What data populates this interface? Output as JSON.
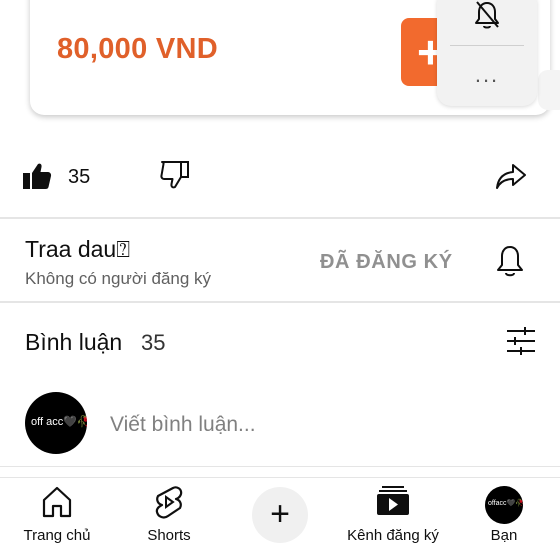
{
  "product": {
    "price": "80,000 VND",
    "buy_button_glyph": "+"
  },
  "popup_menu": {
    "icons": [
      "bell-off-icon"
    ],
    "more_label": "..."
  },
  "actions": {
    "like_count": "35",
    "icons": [
      "thumbs-up-icon",
      "thumbs-down-icon",
      "share-icon"
    ]
  },
  "channel": {
    "name": "Traa dau⍰",
    "subscribers": "Không có người đăng ký",
    "subscribe_label": "ĐÃ ĐĂNG KÝ",
    "bell_icon": "bell-icon"
  },
  "comments": {
    "title": "Bình luận",
    "count": "35",
    "input_placeholder": "Viết bình luận...",
    "avatar_text": "off acc🖤🥀"
  },
  "bottom_nav": {
    "items": [
      {
        "label": "Trang chủ",
        "icon": "home-icon"
      },
      {
        "label": "Shorts",
        "icon": "shorts-icon"
      },
      {
        "label": "",
        "icon": "create-plus-icon"
      },
      {
        "label": "Kênh đăng ký",
        "icon": "subscriptions-icon"
      },
      {
        "label": "Bạn",
        "icon": "you-avatar"
      }
    ],
    "you_avatar_text": "offacc🖤🥀"
  },
  "colors": {
    "price": "#e0602a",
    "buy_button": "#f26a2e",
    "subscribed_text": "#909090"
  }
}
